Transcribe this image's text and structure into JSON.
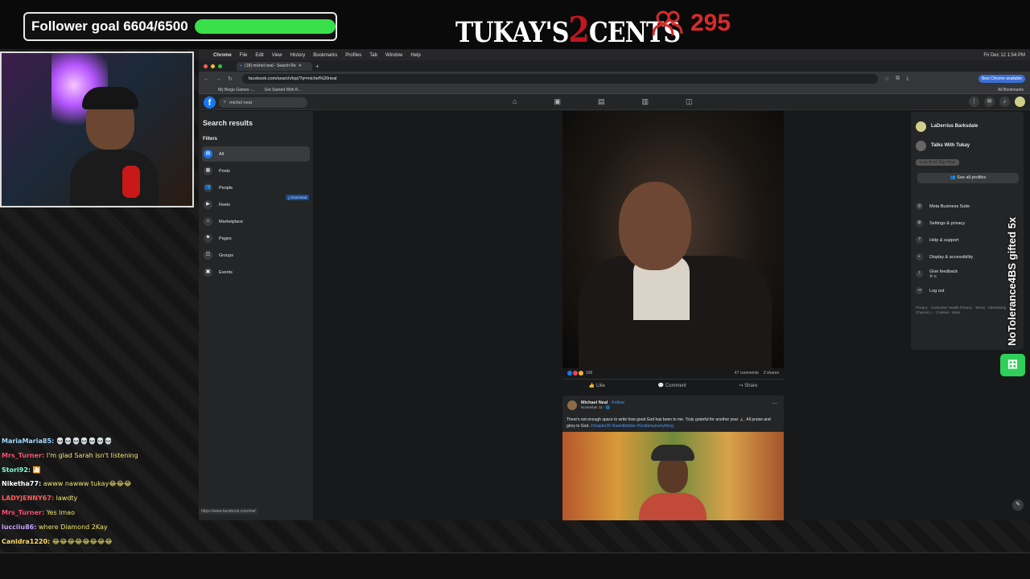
{
  "overlay": {
    "follower_goal_label": "Follower goal 6604/6500",
    "follower_progress": 1.0,
    "logo_pre": "TUKAY'S",
    "logo_two": "2",
    "logo_post": "CENTS",
    "viewer_count": "295",
    "gift_text": "NoTolerance4BS gifted 5x",
    "colors": {
      "goal_fill": "#39e04a",
      "viewer_red": "#d62b2b",
      "brand_red": "#c0161f"
    }
  },
  "chat": [
    {
      "user": "MariaMaria85:",
      "user_color": "#9fd7ff",
      "msg": "💀💀💀💀💀💀💀"
    },
    {
      "user": "Mrs_Turner:",
      "user_color": "#ff4d6d",
      "msg": "I'm glad Sarah isn't listening"
    },
    {
      "user": "Stori92:",
      "user_color": "#7fffd4",
      "msg": "🎦"
    },
    {
      "user": "Niketha77:",
      "user_color": "#ffffff",
      "msg": "awww nawww tukay😂😂😂"
    },
    {
      "user": "LADYJENNY67:",
      "user_color": "#ff5c5c",
      "msg": "lawdty"
    },
    {
      "user": "Mrs_Turner:",
      "user_color": "#ff4d6d",
      "msg": "Yes lmao"
    },
    {
      "user": "lucciiu86:",
      "user_color": "#c7a2ff",
      "msg": "where Diamond 2Kay"
    },
    {
      "user": "Canidra1220:",
      "user_color": "#ffd966",
      "msg": "😂😂😂😂😂😂😂😂"
    }
  ],
  "browser": {
    "menu": [
      "Chrome",
      "File",
      "Edit",
      "View",
      "History",
      "Bookmarks",
      "Profiles",
      "Tab",
      "Window",
      "Help"
    ],
    "clock": "Fri Dec 12  1:54 PM",
    "tab_title": "(18) michel neal - Search Re",
    "url": "facebook.com/search/top/?q=michel%20neal",
    "new_chrome": "New Chrome available",
    "bookmarks": [
      "My Bingo Games -...",
      "Get Started With R..."
    ],
    "all_bookmarks": "All Bookmarks"
  },
  "facebook": {
    "search_value": "michel neal",
    "search_results_title": "Search results",
    "filters_label": "Filters",
    "filters": [
      {
        "label": "All",
        "icon": "▤"
      },
      {
        "label": "Posts",
        "icon": "▦"
      },
      {
        "label": "People",
        "icon": "👥"
      },
      {
        "label": "Reels",
        "icon": "▶"
      },
      {
        "label": "Marketplace",
        "icon": "⌂"
      },
      {
        "label": "Pages",
        "icon": "⚑"
      },
      {
        "label": "Groups",
        "icon": "☷"
      },
      {
        "label": "Events",
        "icon": "▣"
      }
    ],
    "download_label": "Download",
    "post1": {
      "reactions_count": "106",
      "comments": "47 comments",
      "shares": "2 shares",
      "like": "Like",
      "comment": "Comment",
      "share": "Share"
    },
    "post2": {
      "author": "Michael Neal",
      "follow": "· Follow",
      "date": "November 11 · 🌐",
      "text": "There's not enough space to write how good God has been to me. Truly grateful for another year 🙏🏾. All praise and glory to God.",
      "tags": "#chapter39 #lastofthirties #Godismyeverything"
    },
    "status_url": "https://www.facebook.com/me/",
    "account_menu": {
      "profiles": [
        "LaDerrius Barksdale",
        "Talks With Tukay",
        "Luv And Sip Hop"
      ],
      "see_all": "See all profiles",
      "items": [
        {
          "label": "Meta Business Suite",
          "icon": "◎"
        },
        {
          "label": "Settings & privacy",
          "icon": "⚙"
        },
        {
          "label": "Help & support",
          "icon": "?"
        },
        {
          "label": "Display & accessibility",
          "icon": "◐"
        },
        {
          "label": "Give feedback",
          "icon": "!",
          "sub": "⌘ B"
        },
        {
          "label": "Log out",
          "icon": "⇥"
        }
      ],
      "footer": "Privacy · Consumer Health Privacy · Terms · Advertising · Ad Choices ▷ · Cookies · More"
    }
  }
}
